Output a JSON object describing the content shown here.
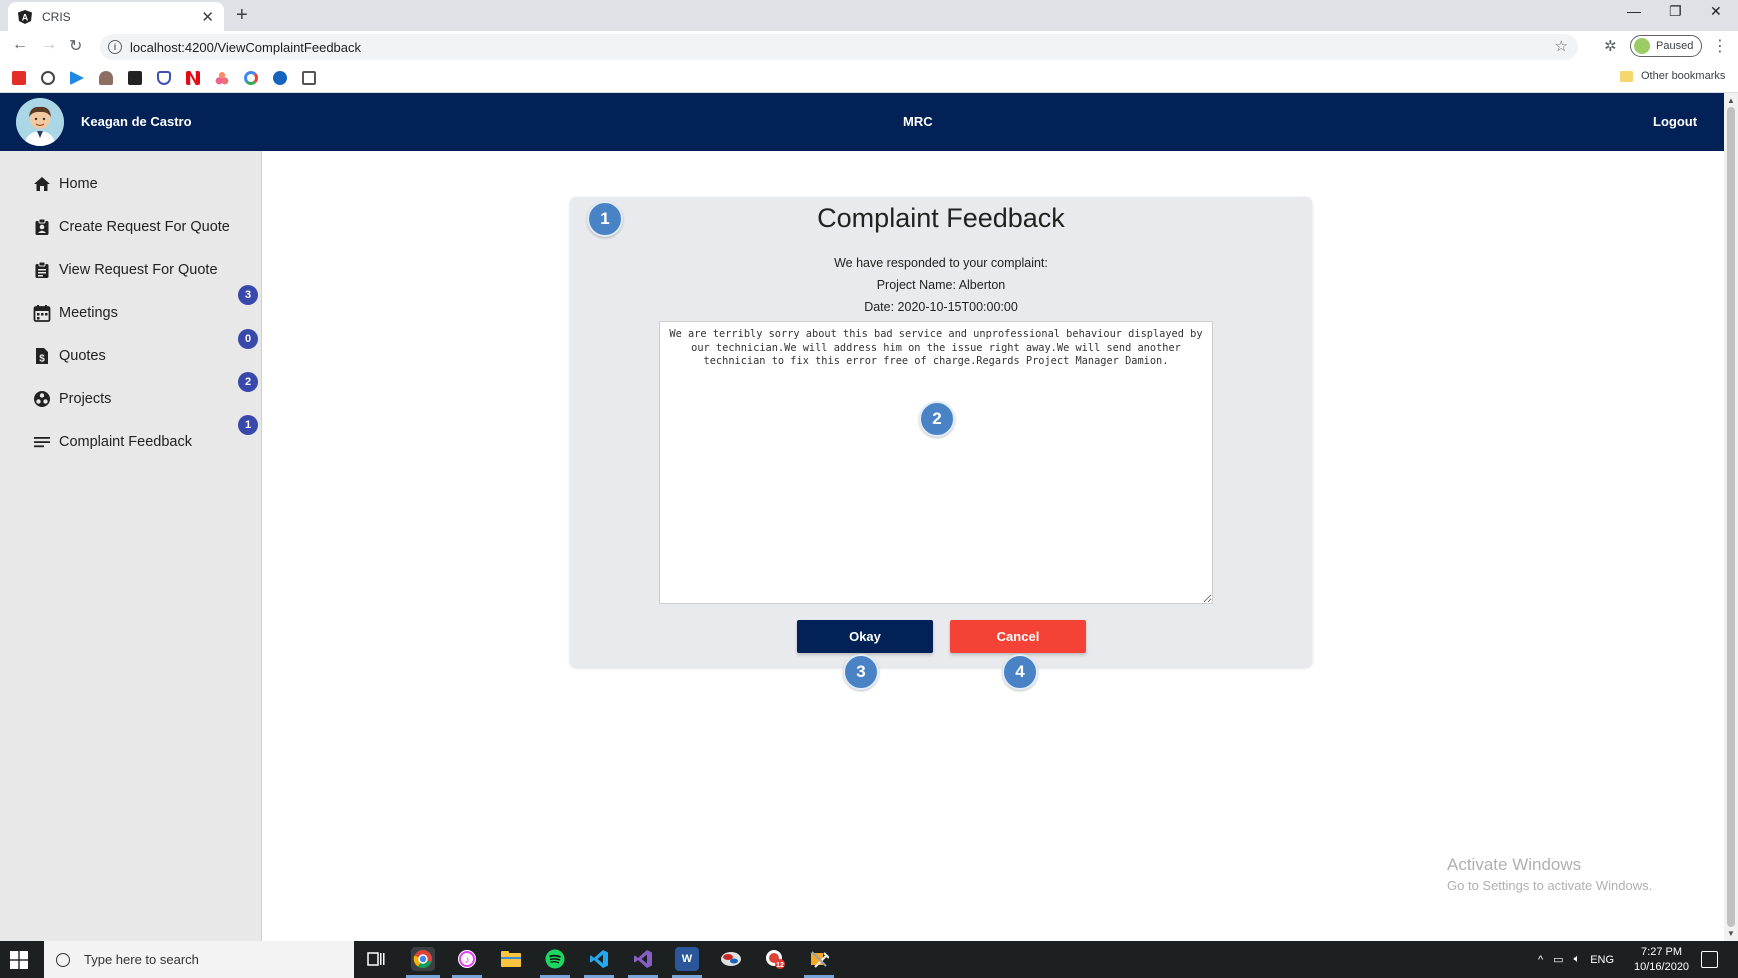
{
  "browser": {
    "tab_title": "CRIS",
    "url": "localhost:4200/ViewComplaintFeedback",
    "profile_label": "Paused",
    "other_bookmarks": "Other bookmarks"
  },
  "header": {
    "username": "Keagan de Castro",
    "brand": "MRC",
    "logout_label": "Logout",
    "bg_color": "#022157"
  },
  "sidebar": {
    "items": [
      {
        "label": "Home",
        "icon": "home-icon"
      },
      {
        "label": "Create Request For Quote",
        "icon": "clipboard-user-icon"
      },
      {
        "label": "View Request For Quote",
        "icon": "clipboard-list-icon"
      },
      {
        "label": "Meetings",
        "icon": "calendar-icon"
      },
      {
        "label": "Quotes",
        "icon": "dollar-file-icon"
      },
      {
        "label": "Projects",
        "icon": "projects-icon"
      },
      {
        "label": "Complaint Feedback",
        "icon": "list-lines-icon"
      }
    ],
    "badges": [
      "3",
      "0",
      "2",
      "1"
    ],
    "badge_color": "#3949ab"
  },
  "card": {
    "title": "Complaint Feedback",
    "intro": "We have responded to your complaint:",
    "project_line": "Project Name: Alberton",
    "date_line": "Date: 2020-10-15T00:00:00",
    "feedback_text": "We are terribly sorry about this bad service and unprofessional behaviour displayed by our technician.We will address him on the issue right away.We will send another technician to fix this error free of charge.Regards Project Manager Damion.",
    "okay_label": "Okay",
    "cancel_label": "Cancel",
    "okay_color": "#022157",
    "cancel_color": "#f44336"
  },
  "markers": [
    "1",
    "2",
    "3",
    "4"
  ],
  "watermark": {
    "line1": "Activate Windows",
    "line2": "Go to Settings to activate Windows."
  },
  "taskbar": {
    "search_placeholder": "Type here to search",
    "lang": "ENG",
    "time": "7:27 PM",
    "date": "10/16/2020"
  }
}
